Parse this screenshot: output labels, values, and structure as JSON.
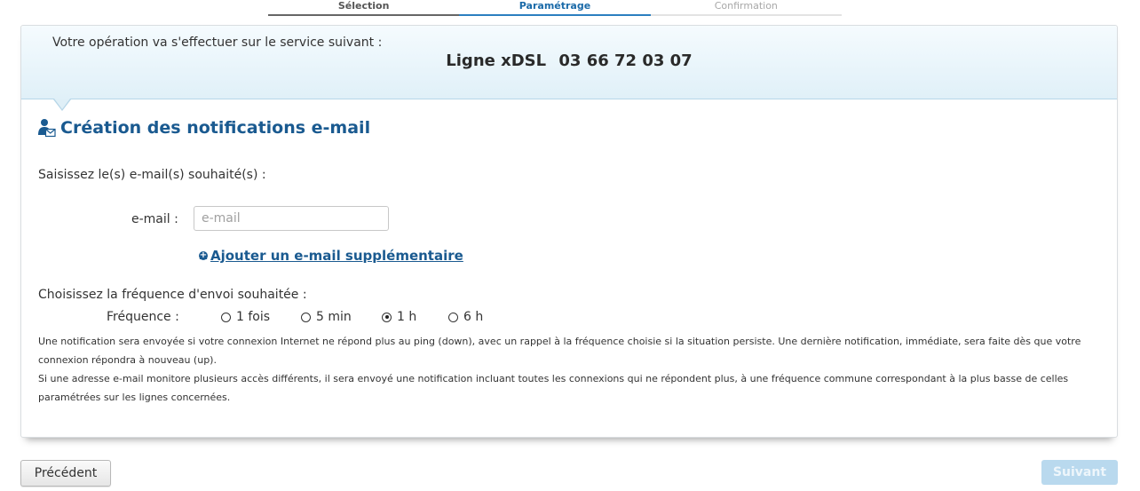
{
  "steps": [
    {
      "label": "Sélection",
      "state": "done"
    },
    {
      "label": "Paramétrage",
      "state": "active"
    },
    {
      "label": "Confirmation",
      "state": "todo"
    }
  ],
  "service": {
    "label": "Votre opération va s'effectuer sur le service suivant :",
    "type": "Ligne xDSL",
    "number": "03 66 72 03 07"
  },
  "section": {
    "title": "Création des notifications e-mail",
    "icon": "user-mail-icon"
  },
  "email": {
    "prompt": "Saisissez le(s) e-mail(s) souhaité(s) :",
    "label": "e-mail :",
    "value": "",
    "placeholder": "e-mail",
    "add_link": "Ajouter un e-mail supplémentaire"
  },
  "frequency": {
    "prompt": "Choisissez la fréquence d'envoi souhaitée :",
    "label": "Fréquence :",
    "options": [
      "1 fois",
      "5 min",
      "1 h",
      "6 h"
    ],
    "selected": "1 h"
  },
  "info": [
    "Une notification sera envoyée si votre connexion Internet ne répond plus au ping (down), avec un rappel à la fréquence choisie si la situation persiste. Une dernière notification, immédiate, sera faite dès que votre connexion répondra à nouveau (up).",
    "Si une adresse e-mail monitore plusieurs accès différents, il sera envoyé une notification incluant toutes les connexions qui ne répondent plus, à une fréquence commune correspondant à la plus basse de celles paramétrées sur les lignes concernées."
  ],
  "buttons": {
    "previous": "Précédent",
    "next": "Suivant"
  },
  "colors": {
    "accent": "#1a5a90",
    "step_active": "#2b7fc0",
    "next_disabled": "#b9d9ee"
  }
}
